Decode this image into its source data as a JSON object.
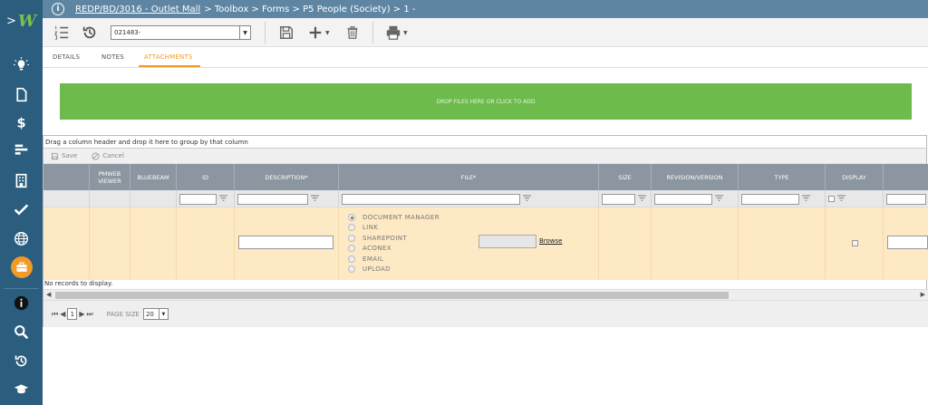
{
  "sidebar": {
    "logo_chevron": ">",
    "logo_letter": "W",
    "items": [
      "lightbulb-icon",
      "document-icon",
      "dollar-icon",
      "gantt-icon",
      "building-icon",
      "check-icon",
      "globe-icon",
      "briefcase-icon",
      "info-icon",
      "search-icon",
      "history-icon",
      "graduation-cap-icon"
    ]
  },
  "header": {
    "record_link": "REDP/BD/3016 - Outlet Mall",
    "crumb_rest": "> Toolbox > Forms > P5 People (Society) > 1 -"
  },
  "toolbar": {
    "record_select_value": "021483-"
  },
  "tabs": [
    {
      "label": "DETAILS"
    },
    {
      "label": "NOTES"
    },
    {
      "label": "ATTACHMENTS",
      "active": true
    }
  ],
  "dropzone": {
    "label": "DROP FILES HERE OR CLICK TO ADD"
  },
  "grid": {
    "group_hint": "Drag a column header and drop it here to group by that column",
    "save_label": "Save",
    "cancel_label": "Cancel",
    "columns": {
      "pmweb_viewer": "PMWEB VIEWER",
      "bluebeam": "BLUEBEAM",
      "id": "ID",
      "description": "DESCRIPTION*",
      "file": "FILE*",
      "size": "SIZE",
      "revision": "REVISION/VERSION",
      "type": "TYPE",
      "display": "DISPLAY"
    },
    "file_sources": [
      "DOCUMENT MANAGER",
      "LINK",
      "SHAREPOINT",
      "ACONEX",
      "EMAIL",
      "UPLOAD"
    ],
    "selected_source": "DOCUMENT MANAGER",
    "browse_label": "Browse",
    "no_records": "No records to display.",
    "pager": {
      "current_page": "1",
      "page_size_label": "PAGE SIZE",
      "page_size_value": "20"
    }
  }
}
